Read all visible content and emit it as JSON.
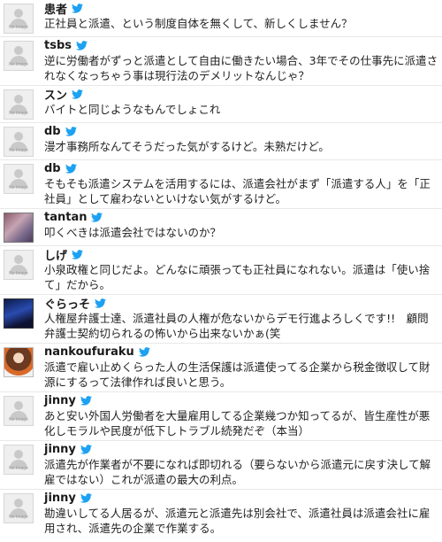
{
  "tweets": [
    {
      "user": "患者",
      "text": "正社員と派遣、という制度自体を無くして、新しくしません？",
      "avatar": "no-image",
      "avatar_label": "No Image"
    },
    {
      "user": "tsbs",
      "text": "逆に労働者がずっと派遣として自由に働きたい場合、3年でその仕事先に派遣されなくなっちゃう事は現行法のデメリットなんじゃ？",
      "avatar": "no-image",
      "avatar_label": "No Image"
    },
    {
      "user": "スン",
      "text": "バイトと同じようなもんでしょこれ",
      "avatar": "no-image",
      "avatar_label": "No Image"
    },
    {
      "user": "db",
      "text": "漫才事務所なんてそうだった気がするけど。未熟だけど。",
      "avatar": "no-image",
      "avatar_label": "No Image"
    },
    {
      "user": "db",
      "text": "そもそも派遣システムを活用するには、派遣会社がまず「派遣する人」を「正社員」として雇わないといけない気がするけど。",
      "avatar": "no-image",
      "avatar_label": "No Image"
    },
    {
      "user": "tantan",
      "text": "叩くべきは派遣会社ではないのか？",
      "avatar": "photo-a",
      "avatar_label": ""
    },
    {
      "user": "しげ",
      "text": "小泉政権と同じだよ。どんなに頑張っても正社員になれない。派遣は「使い捨て」だから。",
      "avatar": "no-image",
      "avatar_label": "No Image"
    },
    {
      "user": "ぐらっそ",
      "text": "人権屋弁護士達、派遣社員の人権が危ないからデモ行進よろしくです!!　顧問弁護士契約切られるの怖いから出来ないかぁ(笑",
      "avatar": "photo-b",
      "avatar_label": ""
    },
    {
      "user": "nankoufuraku",
      "text": "派遣で雇い止めくらった人の生活保護は派遣使ってる企業から税金徴収して財源にするって法律作れば良いと思う。",
      "avatar": "photo-c",
      "avatar_label": ""
    },
    {
      "user": "jinny",
      "text": "あと安い外国人労働者を大量雇用してる企業幾つか知ってるが、皆生産性が悪化しモラルや民度が低下しトラブル続発だぞ（本当）",
      "avatar": "no-image",
      "avatar_label": "No Image"
    },
    {
      "user": "jinny",
      "text": "派遣先が作業者が不要になれば即切れる（要らないから派遣元に戻す決して解雇ではない）これが派遣の最大の利点。",
      "avatar": "no-image",
      "avatar_label": "No Image"
    },
    {
      "user": "jinny",
      "text": "勘違いしてる人居るが、派遣元と派遣先は別会社で、派遣社員は派遣会社に雇用され、派遣先の企業で作業する。",
      "avatar": "no-image",
      "avatar_label": "No Image"
    }
  ],
  "icons": {
    "service": "twitter-bird-icon"
  },
  "colors": {
    "accent": "#1da1f2",
    "text": "#222222",
    "divider": "#e8e8e8"
  }
}
